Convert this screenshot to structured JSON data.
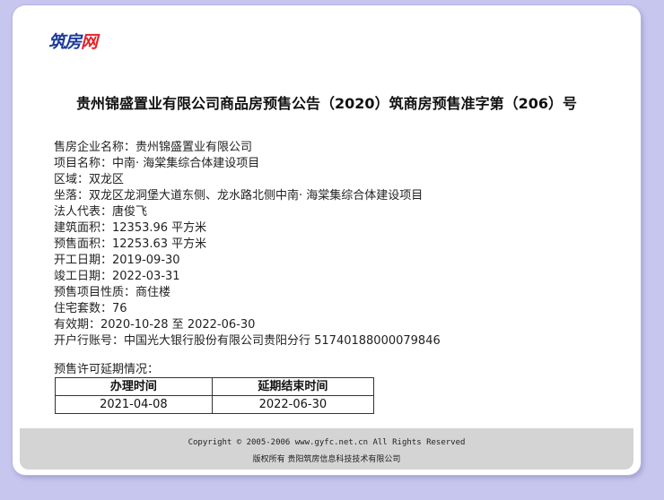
{
  "logo": {
    "part1": "筑房",
    "part2": "网"
  },
  "title": "贵州锦盛置业有限公司商品房预售公告（2020）筑商房预售准字第（206）号",
  "info": [
    "售房企业名称：贵州锦盛置业有限公司",
    "项目名称：中南· 海棠集综合体建设项目",
    "区域：双龙区",
    "坐落：双龙区龙洞堡大道东侧、龙水路北侧中南· 海棠集综合体建设项目",
    "法人代表：唐俊飞",
    "建筑面积：12353.96 平方米",
    "预售面积：12253.63 平方米",
    "开工日期：2019-09-30",
    "竣工日期：2022-03-31",
    "预售项目性质：商住楼",
    "住宅套数：76",
    "有效期：2020-10-28 至 2022-06-30",
    "开户行账号：中国光大银行股份有限公司贵阳分行 51740188000079846"
  ],
  "extension": {
    "title": "预售许可延期情况：",
    "headers": [
      "办理时间",
      "延期结束时间"
    ],
    "rows": [
      [
        "2021-04-08",
        "2022-06-30"
      ]
    ]
  },
  "footer": {
    "copyright": "Copyright © 2005-2006 www.gyfc.net.cn All Rights Reserved",
    "owner": "版权所有 贵阳筑房信息科技技术有限公司"
  }
}
